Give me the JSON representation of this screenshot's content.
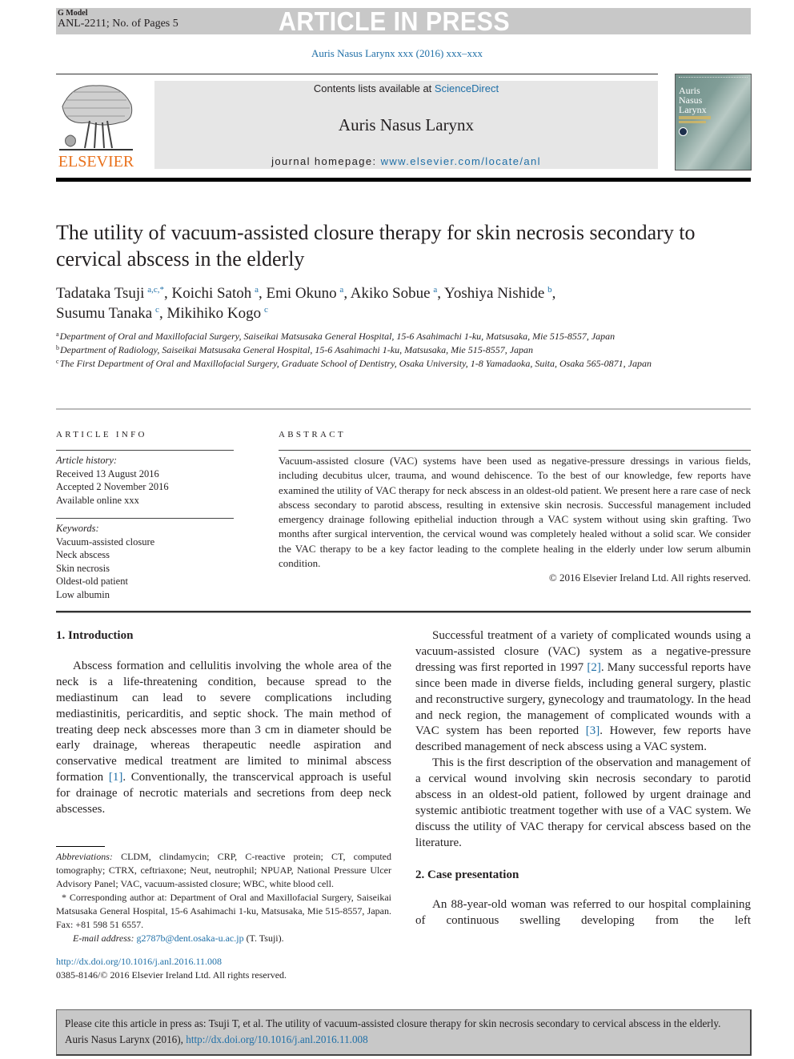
{
  "banner": {
    "model": "G Model",
    "ref": "ANL-2211; No. of Pages 5",
    "status": "ARTICLE IN PRESS"
  },
  "journal_ref": "Auris Nasus Larynx xxx (2016) xxx–xxx",
  "masthead": {
    "publisher": "ELSEVIER",
    "contents_prefix": "Contents lists available at ",
    "contents_link": "ScienceDirect",
    "journal_title": "Auris Nasus Larynx",
    "homepage_prefix": "journal homepage: ",
    "homepage_link": "www.elsevier.com/locate/anl",
    "cover_title": [
      "Auris",
      "Nasus",
      "Larynx"
    ]
  },
  "article": {
    "title": "The utility of vacuum-assisted closure therapy for skin necrosis secondary to cervical abscess in the elderly",
    "authors": [
      {
        "name": "Tadataka Tsuji",
        "aff": "a,c,*",
        "sep": ", "
      },
      {
        "name": "Koichi Satoh",
        "aff": "a",
        "sep": ", "
      },
      {
        "name": "Emi Okuno",
        "aff": "a",
        "sep": ", "
      },
      {
        "name": "Akiko Sobue",
        "aff": "a",
        "sep": ", "
      },
      {
        "name": "Yoshiya Nishide",
        "aff": "b",
        "sep": ","
      },
      {
        "name": "Susumu Tanaka",
        "aff": "c",
        "sep": ", "
      },
      {
        "name": "Mikihiko Kogo",
        "aff": "c",
        "sep": ""
      }
    ],
    "affiliations": [
      {
        "key": "a",
        "text": "Department of Oral and Maxillofacial Surgery, Saiseikai Matsusaka General Hospital, 15-6 Asahimachi 1-ku, Matsusaka, Mie 515-8557, Japan"
      },
      {
        "key": "b",
        "text": "Department of Radiology, Saiseikai Matsusaka General Hospital, 15-6 Asahimachi 1-ku, Matsusaka, Mie 515-8557, Japan"
      },
      {
        "key": "c",
        "text": "The First Department of Oral and Maxillofacial Surgery, Graduate School of Dentistry, Osaka University, 1-8 Yamadaoka, Suita, Osaka 565-0871, Japan"
      }
    ]
  },
  "article_info": {
    "heading": "ARTICLE INFO",
    "history_label": "Article history:",
    "history": [
      "Received 13 August 2016",
      "Accepted 2 November 2016",
      "Available online xxx"
    ],
    "keywords_label": "Keywords:",
    "keywords": [
      "Vacuum-assisted closure",
      "Neck abscess",
      "Skin necrosis",
      "Oldest-old patient",
      "Low albumin"
    ]
  },
  "abstract": {
    "heading": "ABSTRACT",
    "text": "Vacuum-assisted closure (VAC) systems have been used as negative-pressure dressings in various fields, including decubitus ulcer, trauma, and wound dehiscence. To the best of our knowledge, few reports have examined the utility of VAC therapy for neck abscess in an oldest-old patient. We present here a rare case of neck abscess secondary to parotid abscess, resulting in extensive skin necrosis. Successful management included emergency drainage following epithelial induction through a VAC system without using skin grafting. Two months after surgical intervention, the cervical wound was completely healed without a solid scar. We consider the VAC therapy to be a key factor leading to the complete healing in the elderly under low serum albumin condition.",
    "copyright": "© 2016 Elsevier Ireland Ltd. All rights reserved."
  },
  "body": {
    "intro_heading": "1.  Introduction",
    "intro_p1_a": "Abscess formation and cellulitis involving the whole area of the neck is a life-threatening condition, because spread to the mediastinum can lead to severe complications including mediastinitis, pericarditis, and septic shock. The main method of treating deep neck abscesses more than 3 cm in diameter should be early drainage, whereas therapeutic needle aspiration and conservative medical treatment are limited to minimal abscess formation ",
    "ref1": "[1]",
    "intro_p1_b": ". Conventionally, the transcervical approach is useful for drainage of necrotic materials and secretions from deep neck abscesses.",
    "p2_a": "Successful treatment of a variety of complicated wounds using a vacuum-assisted closure (VAC) system as a negative-pressure dressing was first reported in 1997 ",
    "ref2": "[2]",
    "p2_b": ". Many successful reports have since been made in diverse fields, including general surgery, plastic and reconstructive surgery, gynecology and traumatology. In the head and neck region, the management of complicated wounds with a VAC system has been reported ",
    "ref3": "[3]",
    "p2_c": ". However, few reports have described management of neck abscess using a VAC system.",
    "p3": "This is the first description of the observation and management of a cervical wound involving skin necrosis secondary to parotid abscess in an oldest-old patient, followed by urgent drainage and systemic antibiotic treatment together with use of a VAC system. We discuss the utility of VAC therapy for cervical abscess based on the literature.",
    "case_heading": "2.  Case presentation",
    "case_p1": "An 88-year-old woman was referred to our hospital complaining of continuous swelling developing from the left"
  },
  "footnotes": {
    "abbrev_label": "Abbreviations:",
    "abbrev_text": " CLDM, clindamycin; CRP, C-reactive protein; CT, computed tomography; CTRX, ceftriaxone; Neut, neutrophil; NPUAP, National Pressure Ulcer Advisory Panel; VAC, vacuum-assisted closure; WBC, white blood cell.",
    "corresponding": "* Corresponding author at: Department of Oral and Maxillofacial Surgery, Saiseikai Matsusaka General Hospital, 15-6 Asahimachi 1-ku, Matsusaka, Mie 515-8557, Japan. Fax: +81 598 51 6557.",
    "email_label": "E-mail address:",
    "email": "g2787b@dent.osaka-u.ac.jp",
    "email_suffix": " (T. Tsuji).",
    "doi": "http://dx.doi.org/10.1016/j.anl.2016.11.008",
    "issn": "0385-8146/© 2016 Elsevier Ireland Ltd. All rights reserved."
  },
  "cite_box": {
    "text": "Please cite this article in press as: Tsuji T, et al. The utility of vacuum-assisted closure therapy for skin necrosis secondary to cervical abscess in the elderly. Auris Nasus Larynx (2016), ",
    "link": "http://dx.doi.org/10.1016/j.anl.2016.11.008"
  }
}
